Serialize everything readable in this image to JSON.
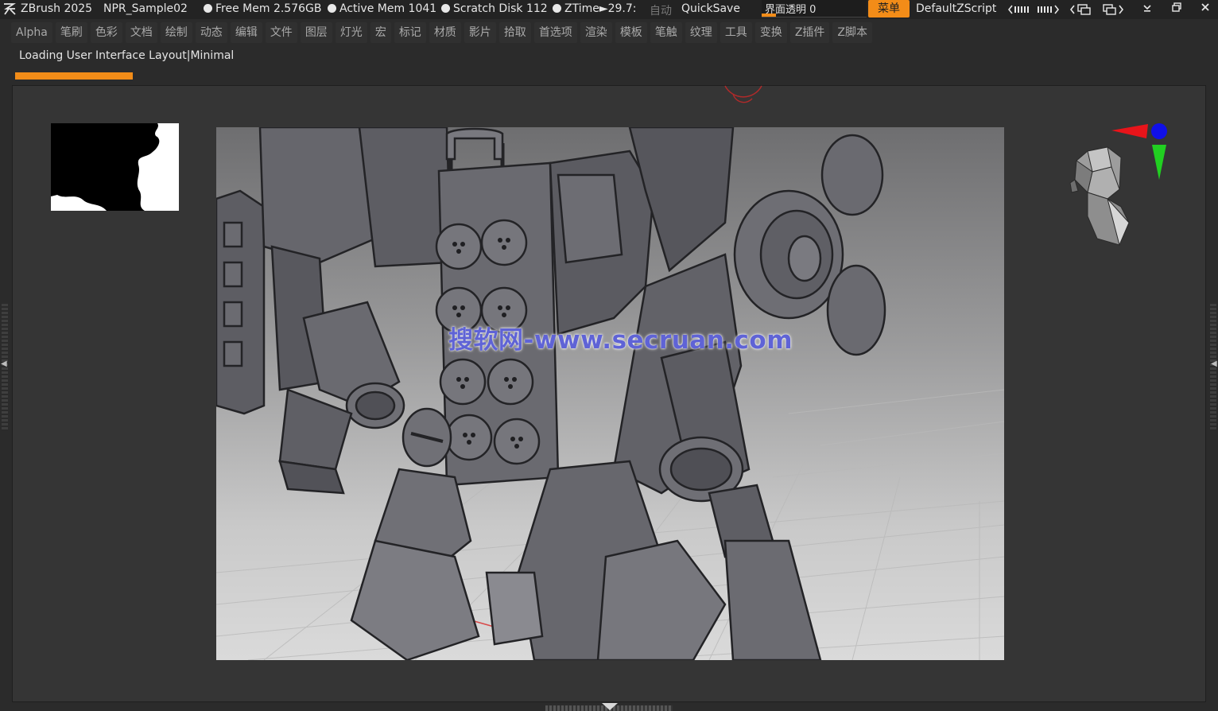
{
  "titlebar": {
    "app_name": "ZBrush 2025",
    "document": "NPR_Sample02",
    "free_mem": "Free Mem 2.576GB",
    "active_mem": "Active Mem 1041",
    "scratch_disk": "Scratch Disk 112",
    "ztime": "ZTime►29.7:",
    "auto": "自动",
    "quicksave": "QuickSave",
    "transparency_label": "界面透明 0",
    "transparency_value": 0,
    "menu_button": "菜单",
    "script": "DefaultZScript"
  },
  "menubar": {
    "items": [
      "Alpha",
      "笔刷",
      "色彩",
      "文档",
      "绘制",
      "动态",
      "编辑",
      "文件",
      "图层",
      "灯光",
      "宏",
      "标记",
      "材质",
      "影片",
      "拾取",
      "首选项",
      "渲染",
      "模板",
      "笔触",
      "纹理",
      "工具",
      "变换",
      "Z插件",
      "Z脚本"
    ]
  },
  "status": {
    "loading_text": "Loading User Interface Layout|Minimal"
  },
  "viewport": {
    "watermark": "搜软网-www.secruan.com"
  },
  "colors": {
    "accent": "#f28c18",
    "axis_x": "#e8141a",
    "axis_y": "#21d021",
    "axis_z": "#1010e8"
  },
  "icons": {
    "app": "zbrush-logo-icon",
    "window": [
      "minimize-icon",
      "restore-icon",
      "close-icon"
    ]
  }
}
